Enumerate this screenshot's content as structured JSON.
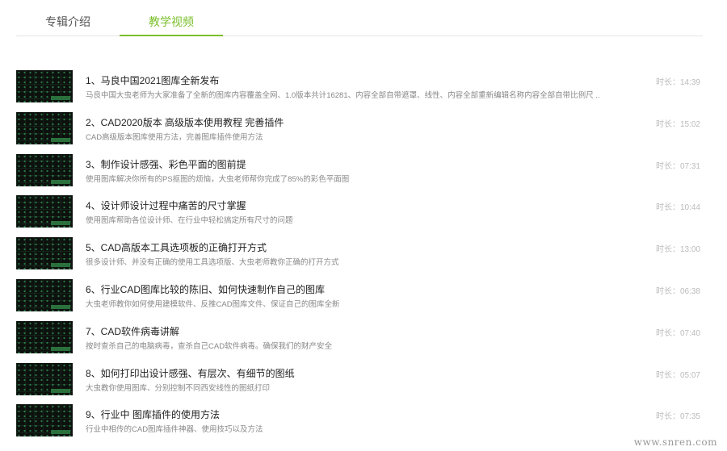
{
  "tabs": [
    {
      "label": "专辑介绍",
      "active": false
    },
    {
      "label": "教学视频",
      "active": true
    }
  ],
  "accent_color": "#7bbf2a",
  "duration_prefix": "时长：",
  "videos": [
    {
      "title": "1、马良中国2021图库全新发布",
      "desc": "马良中国大虫老师为大家准备了全新的图库内容覆盖全网、1.0版本共计16281、内容全部自带遮罩、线性、内容全部重新编辑名称内容全部自带比例尺 ..",
      "duration": "14:39"
    },
    {
      "title": "2、CAD2020版本 高级版本使用教程 完善插件",
      "desc": "CAD高级版本图库使用方法，完善图库插件使用方法",
      "duration": "15:02"
    },
    {
      "title": "3、制作设计感强、彩色平面的图前提",
      "desc": "使用图库解决你所有的PS抠图的烦恼，大虫老师帮你完成了85%的彩色平面图",
      "duration": "07:31"
    },
    {
      "title": "4、设计师设计过程中痛苦的尺寸掌握",
      "desc": "使用图库帮助各位设计师、在行业中轻松搞定所有尺寸的问题",
      "duration": "10:44"
    },
    {
      "title": "5、CAD高版本工具选项板的正确打开方式",
      "desc": "很多设计师、并没有正确的使用工具选项版、大虫老师教你正确的打开方式",
      "duration": "13:00"
    },
    {
      "title": "6、行业CAD图库比较的陈旧、如何快速制作自己的图库",
      "desc": "大虫老师教你如何使用建模软件、反推CAD图库文件、保证自己的图库全新",
      "duration": "06:38"
    },
    {
      "title": "7、CAD软件病毒讲解",
      "desc": "按时查杀自己的电脑病毒，查杀自己CAD软件病毒。确保我们的财产安全",
      "duration": "07:40"
    },
    {
      "title": "8、如何打印出设计感强、有层次、有细节的图纸",
      "desc": "大虫教你使用图库、分别控制不同西安线性的图纸打印",
      "duration": "05:07"
    },
    {
      "title": "9、行业中 图库插件的使用方法",
      "desc": "行业中相传的CAD图库插件神器、使用技巧以及方法",
      "duration": "07:35"
    }
  ],
  "watermark": "www.snren.com"
}
